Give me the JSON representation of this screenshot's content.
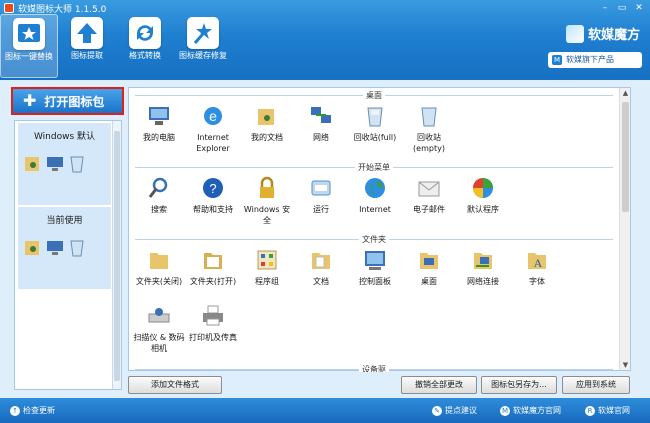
{
  "window": {
    "title": "软媒图标大师 1.1.5.0",
    "min": "–",
    "max": "▭",
    "close": "✕"
  },
  "toolbar": [
    {
      "label": "图标一键替换",
      "icon": "star-icon"
    },
    {
      "label": "图标提取",
      "icon": "upload-arrow-icon"
    },
    {
      "label": "格式转换",
      "icon": "refresh-icon"
    },
    {
      "label": "图标缓存修复",
      "icon": "magic-wand-icon"
    }
  ],
  "brand": {
    "name": "软媒魔方",
    "sub": "软媒旗下产品",
    "sub_icon": "M"
  },
  "open_pack_button": "打开图标包",
  "packs": [
    {
      "title": "Windows 默认"
    },
    {
      "title": "当前使用"
    }
  ],
  "sections": [
    {
      "title": "桌面",
      "items": [
        {
          "label": "我的电脑",
          "icon": "computer-icon"
        },
        {
          "label": "Internet Explorer",
          "icon": "ie-icon"
        },
        {
          "label": "我的文档",
          "icon": "documents-icon"
        },
        {
          "label": "网络",
          "icon": "network-icon"
        },
        {
          "label": "回收站(full)",
          "icon": "recycle-bin-full-icon"
        },
        {
          "label": "回收站(empty)",
          "icon": "recycle-bin-empty-icon"
        }
      ]
    },
    {
      "title": "开始菜单",
      "items": [
        {
          "label": "搜索",
          "icon": "search-icon"
        },
        {
          "label": "帮助和支持",
          "icon": "help-icon"
        },
        {
          "label": "Windows 安全",
          "icon": "lock-icon"
        },
        {
          "label": "运行",
          "icon": "run-icon"
        },
        {
          "label": "Internet",
          "icon": "globe-icon"
        },
        {
          "label": "电子邮件",
          "icon": "email-icon"
        },
        {
          "label": "默认程序",
          "icon": "default-programs-icon"
        }
      ]
    },
    {
      "title": "文件夹",
      "items": [
        {
          "label": "文件夹(关闭)",
          "icon": "folder-closed-icon"
        },
        {
          "label": "文件夹(打开)",
          "icon": "folder-open-icon"
        },
        {
          "label": "程序组",
          "icon": "program-group-icon"
        },
        {
          "label": "文档",
          "icon": "document-folder-icon"
        },
        {
          "label": "控制面板",
          "icon": "control-panel-icon"
        },
        {
          "label": "桌面",
          "icon": "desktop-folder-icon"
        },
        {
          "label": "网络连接",
          "icon": "network-connection-icon"
        },
        {
          "label": "字体",
          "icon": "fonts-icon"
        },
        {
          "label": "扫描仪 & 数码相机",
          "icon": "scanner-icon"
        },
        {
          "label": "打印机及传真",
          "icon": "printer-icon"
        }
      ]
    },
    {
      "title": "设备驱"
    }
  ],
  "buttons": {
    "add_format": "添加文件格式",
    "undo_all": "撤销全部更改",
    "save_as": "图标包另存为...",
    "apply": "应用到系统"
  },
  "status": {
    "check_update": "检查更新",
    "feedback": "提点建议",
    "ruanmei_site": "软媒魔方官网",
    "official_site": "软媒官网"
  }
}
